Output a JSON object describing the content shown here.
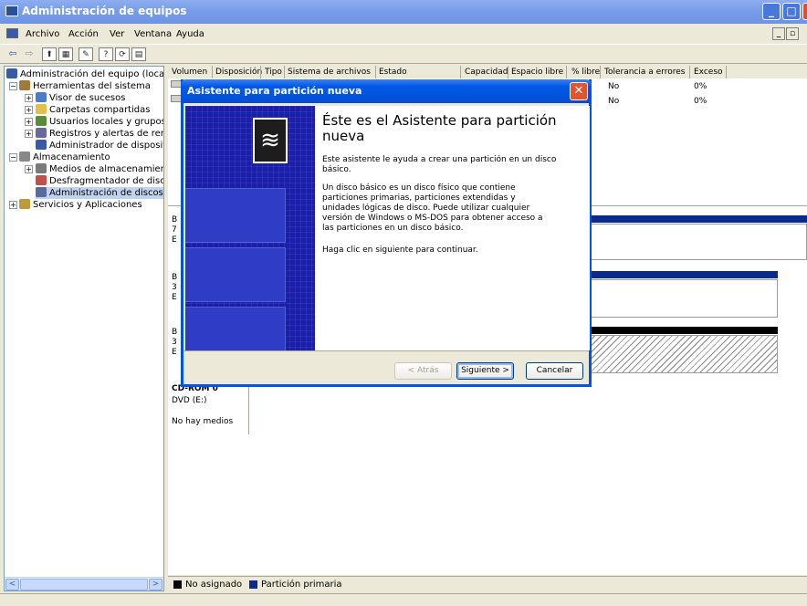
{
  "window": {
    "title": "Administración de equipos"
  },
  "menu": {
    "items": [
      "Archivo",
      "Acción",
      "Ver",
      "Ventana",
      "Ayuda"
    ]
  },
  "toolbar": {
    "icons": [
      "back-arrow-icon",
      "forward-arrow-icon",
      "up-folder-icon",
      "show-hide-tree-icon",
      "properties-icon",
      "help-icon",
      "refresh-icon",
      "export-icon"
    ]
  },
  "tree": {
    "items": [
      {
        "label": "Administración del equipo (local)",
        "icon": "computer-icon"
      },
      {
        "label": "Herramientas del sistema",
        "icon": "tools-icon"
      },
      {
        "label": "Visor de sucesos",
        "icon": "event-viewer-icon"
      },
      {
        "label": "Carpetas compartidas",
        "icon": "shared-folder-icon"
      },
      {
        "label": "Usuarios locales y grupos",
        "icon": "users-icon"
      },
      {
        "label": "Registros y alertas de rendim",
        "icon": "performance-icon"
      },
      {
        "label": "Administrador de dispositivos",
        "icon": "device-manager-icon"
      },
      {
        "label": "Almacenamiento",
        "icon": "storage-icon"
      },
      {
        "label": "Medios de almacenamiento e",
        "icon": "removable-storage-icon"
      },
      {
        "label": "Desfragmentador de disco",
        "icon": "defrag-icon"
      },
      {
        "label": "Administración de discos",
        "icon": "disk-management-icon"
      },
      {
        "label": "Servicios y Aplicaciones",
        "icon": "services-icon"
      }
    ]
  },
  "volumes": {
    "columns": [
      "Volumen",
      "Disposición",
      "Tipo",
      "Sistema de archivos",
      "Estado",
      "Capacidad",
      "Espacio libre",
      "% libre",
      "Tolerancia a errores",
      "Exceso"
    ],
    "rows": [
      {
        "tolerance": "No",
        "overhead": "0%"
      },
      {
        "tolerance": "No",
        "overhead": "0%"
      }
    ]
  },
  "disks": [
    {
      "line1": "B",
      "line2": "7",
      "line3": "E"
    },
    {
      "line1": "B",
      "line2": "3",
      "line3": "E"
    },
    {
      "line1": "B",
      "line2": "3",
      "line3": "E"
    },
    {
      "line1": "CD-ROM 0",
      "line2": "DVD (E:)",
      "line3": "No hay medios"
    }
  ],
  "legend": {
    "unallocated": "No asignado",
    "primary": "Partición primaria",
    "unallocated_color": "#000000",
    "primary_color": "#0a2a8c"
  },
  "wizard": {
    "title": "Asistente para partición nueva",
    "heading": "Éste es el Asistente para partición nueva",
    "p1": "Este asistente le ayuda a crear una partición en un disco básico.",
    "p2": "Un disco básico es un disco físico que contiene particiones primarias, particiones extendidas y unidades lógicas de disco. Puede utilizar cualquier versión de Windows o MS-DOS para obtener acceso a las particiones en un disco básico.",
    "p3": "Haga clic en siguiente para continuar.",
    "back_label": "< Atrás",
    "next_label": "Siguiente >",
    "cancel_label": "Cancelar"
  },
  "colors": {
    "title_bar": "#7a9ee8",
    "wizard_title": "#0055dd",
    "wizard_side": "#1a1ea8"
  }
}
